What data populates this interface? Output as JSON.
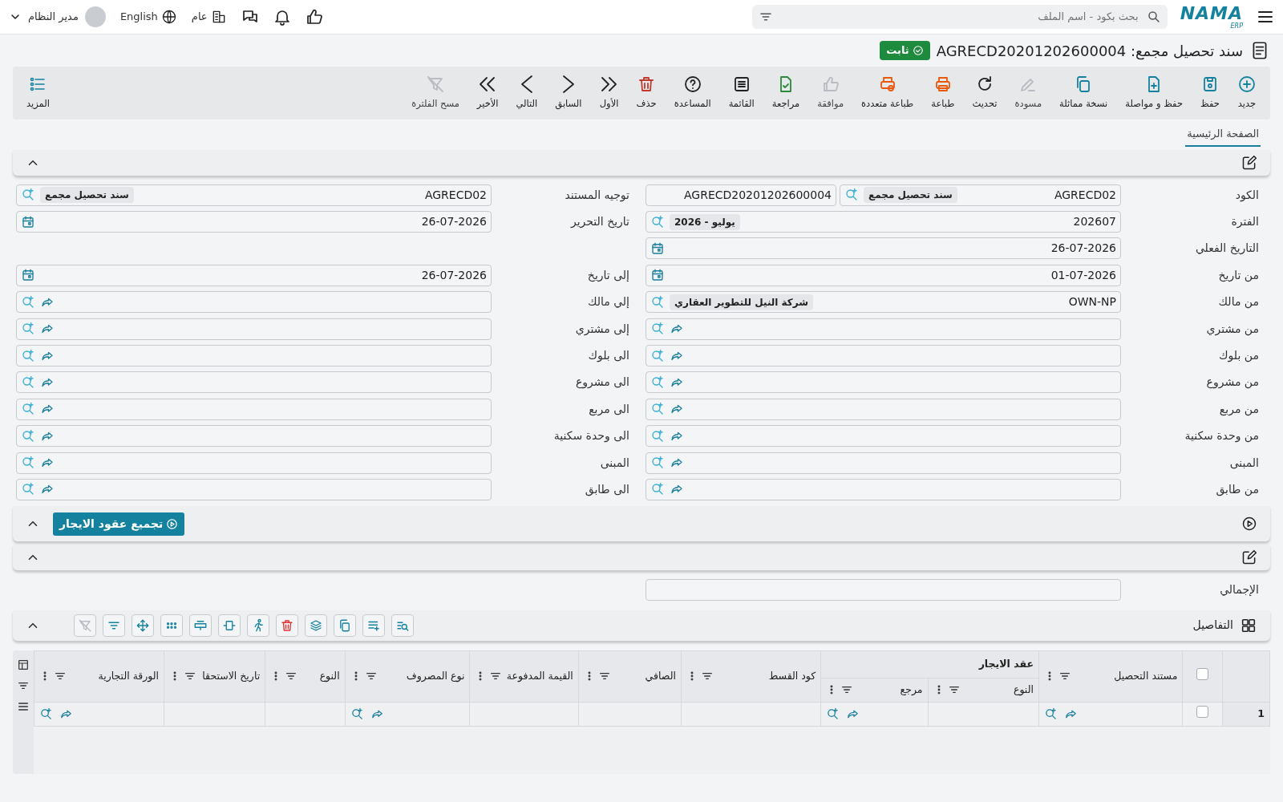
{
  "topbar": {
    "logo": "NAMA",
    "logo_sub": "ERP",
    "search": {
      "placeholder": "بحث بكود - اسم الملف"
    },
    "user": "مدير النظام",
    "language": "English",
    "branch": "عام"
  },
  "title": {
    "text": "سند تحصيل مجمع: AGRECD20201202600004",
    "status": "ثابت"
  },
  "toolbar": [
    {
      "kind": "new",
      "label": "جديد",
      "disabled": false
    },
    {
      "kind": "save",
      "label": "حفظ",
      "disabled": false
    },
    {
      "kind": "save_continue",
      "label": "حفظ و مواصلة",
      "disabled": false
    },
    {
      "kind": "duplicate",
      "label": "نسخة مماثلة",
      "disabled": false
    },
    {
      "kind": "draft",
      "label": "مسودة",
      "disabled": true
    },
    {
      "kind": "refresh",
      "label": "تحديث",
      "disabled": false
    },
    {
      "kind": "print",
      "label": "طباعة",
      "disabled": false
    },
    {
      "kind": "multi_print",
      "label": "طباعة متعددة",
      "disabled": false
    },
    {
      "kind": "approve",
      "label": "موافقة",
      "disabled": true
    },
    {
      "kind": "review",
      "label": "مراجعة",
      "disabled": false
    },
    {
      "kind": "list",
      "label": "القائمة",
      "disabled": false
    },
    {
      "kind": "help",
      "label": "المساعدة",
      "disabled": false
    },
    {
      "kind": "delete",
      "label": "حذف",
      "disabled": false
    },
    {
      "kind": "first",
      "label": "الأول",
      "disabled": false
    },
    {
      "kind": "previous",
      "label": "السابق",
      "disabled": false
    },
    {
      "kind": "next",
      "label": "التالي",
      "disabled": false
    },
    {
      "kind": "last",
      "label": "الأخير",
      "disabled": false
    },
    {
      "kind": "clear_filter",
      "label": "مسح الفلترة",
      "disabled": true
    }
  ],
  "more": "المزيد",
  "tabs": [
    {
      "label": "الصفحة الرئيسية",
      "selected": true
    }
  ],
  "form": {
    "rows": [
      {
        "right": {
          "label": "الكود",
          "kind": "lookup",
          "value": "AGRECD02",
          "tag": "سند تحصيل مجمع",
          "extra_value": "AGRECD20201202600004"
        },
        "left": {
          "label": "توجيه المستند",
          "kind": "lookup",
          "value": "AGRECD02",
          "tag": "سند تحصيل مجمع"
        }
      },
      {
        "right": {
          "label": "الفترة",
          "kind": "lookup",
          "value": "202607",
          "tag": "يوليو - 2026"
        },
        "left": {
          "label": "تاريخ التحرير",
          "kind": "date",
          "value": "26-07-2026"
        }
      },
      {
        "right": {
          "label": "التاريخ الفعلي",
          "kind": "date",
          "value": "26-07-2026"
        }
      },
      {
        "right": {
          "label": "من تاريخ",
          "kind": "date",
          "value": "01-07-2026"
        },
        "left": {
          "label": "إلى تاريخ",
          "kind": "date",
          "value": "26-07-2026"
        }
      },
      {
        "right": {
          "label": "من مالك",
          "kind": "lookup",
          "value": "OWN-NP",
          "tag": "شركة النيل للتطوير العقاري"
        },
        "left": {
          "label": "إلي مالك",
          "kind": "lookup"
        }
      },
      {
        "right": {
          "label": "من مشتري",
          "kind": "lookup"
        },
        "left": {
          "label": "إلى مشتري",
          "kind": "lookup"
        }
      },
      {
        "right": {
          "label": "من بلوك",
          "kind": "lookup"
        },
        "left": {
          "label": "الى بلوك",
          "kind": "lookup"
        }
      },
      {
        "right": {
          "label": "من مشروع",
          "kind": "lookup"
        },
        "left": {
          "label": "الى مشروع",
          "kind": "lookup"
        }
      },
      {
        "right": {
          "label": "من مربع",
          "kind": "lookup"
        },
        "left": {
          "label": "الى مربع",
          "kind": "lookup"
        }
      },
      {
        "right": {
          "label": "من وحدة سكنية",
          "kind": "lookup"
        },
        "left": {
          "label": "الى وحدة سكنية",
          "kind": "lookup"
        }
      },
      {
        "right": {
          "label": "المبنى",
          "kind": "lookup"
        },
        "left": {
          "label": "المبنى",
          "kind": "lookup"
        }
      },
      {
        "right": {
          "label": "من طابق",
          "kind": "lookup"
        },
        "left": {
          "label": "الى طابق",
          "kind": "lookup"
        }
      }
    ]
  },
  "action_button": "تجميع عقود الايجار",
  "totals": {
    "label": "الإجمالي"
  },
  "details": {
    "title": "التفاصيل",
    "tools": [
      {
        "kind": "search_list",
        "disabled": false
      },
      {
        "kind": "add_rows",
        "disabled": false
      },
      {
        "kind": "copy",
        "disabled": false
      },
      {
        "kind": "layers",
        "disabled": false
      },
      {
        "kind": "delete",
        "disabled": false
      },
      {
        "kind": "run",
        "disabled": false
      },
      {
        "kind": "wrap",
        "disabled": false
      },
      {
        "kind": "resize",
        "disabled": false
      },
      {
        "kind": "dots",
        "disabled": false
      },
      {
        "kind": "move",
        "disabled": false
      },
      {
        "kind": "filter",
        "disabled": false
      },
      {
        "kind": "clear_filter",
        "disabled": true
      }
    ],
    "select_all_checked": false,
    "columns": [
      {
        "label": "مستند التحصيل",
        "kind": "lookup"
      },
      {
        "group": "عقد الايجار",
        "children": [
          {
            "label": "النوع",
            "kind": "text"
          },
          {
            "label": "مرجع",
            "kind": "lookup"
          }
        ]
      },
      {
        "label": "كود القسط",
        "kind": "text"
      },
      {
        "label": "الصافي",
        "kind": "text"
      },
      {
        "label": "القيمة المدفوعة",
        "kind": "text"
      },
      {
        "label": "نوع المصروف",
        "kind": "lookup"
      },
      {
        "label": "النوع",
        "kind": "text"
      },
      {
        "label": "تاريخ الاستحقا",
        "kind": "text"
      },
      {
        "label": "الورقة التجارية",
        "kind": "lookup"
      }
    ],
    "rows": [
      {
        "number": "1",
        "checked": false
      }
    ]
  }
}
